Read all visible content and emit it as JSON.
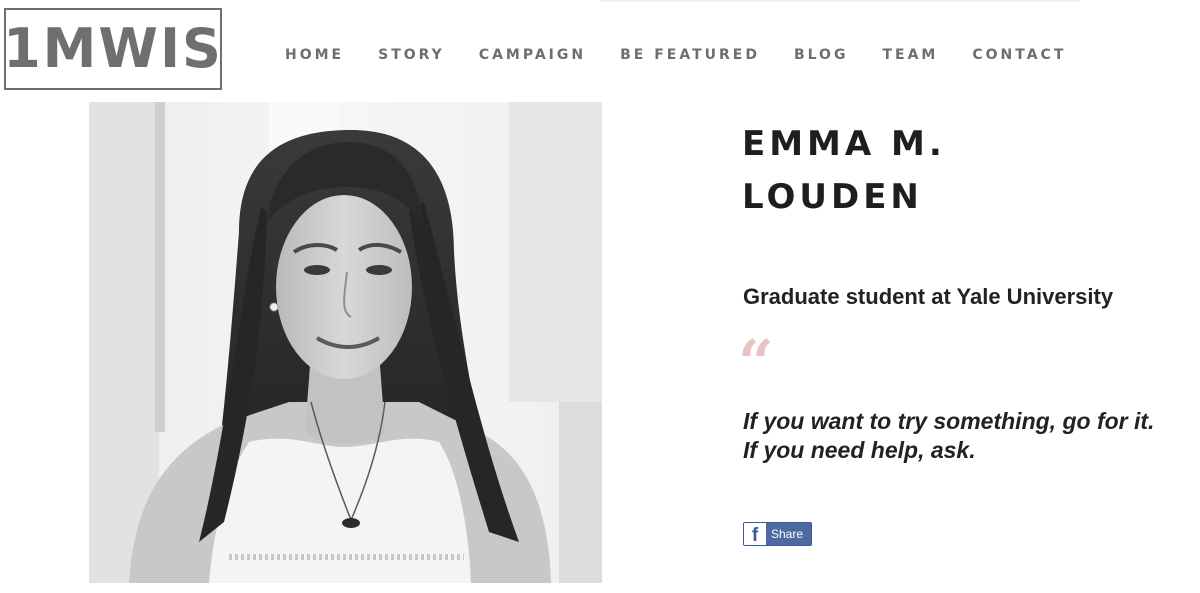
{
  "brand": {
    "logo_text": "1MWIS"
  },
  "nav": {
    "items": [
      {
        "label": "HOME"
      },
      {
        "label": "STORY"
      },
      {
        "label": "CAMPAIGN"
      },
      {
        "label": "BE FEATURED"
      },
      {
        "label": "BLOG"
      },
      {
        "label": "TEAM"
      },
      {
        "label": "CONTACT"
      }
    ]
  },
  "profile": {
    "name_line1": "EMMA M.",
    "name_line2": "LOUDEN",
    "subtitle": "Graduate student at Yale University",
    "quote_mark": "“",
    "quote_line1": "If you want to try something, go for it.",
    "quote_line2": "If you need help, ask.",
    "photo_style": "black-and-white portrait"
  },
  "share": {
    "icon_glyph": "f",
    "label": "Share"
  },
  "colors": {
    "nav_text": "#6e6e6e",
    "logo": "#6f6f6f",
    "quote_mark": "#e9c3c3",
    "facebook_blue": "#4e69a2"
  },
  "icons": {
    "share": "facebook-icon"
  }
}
